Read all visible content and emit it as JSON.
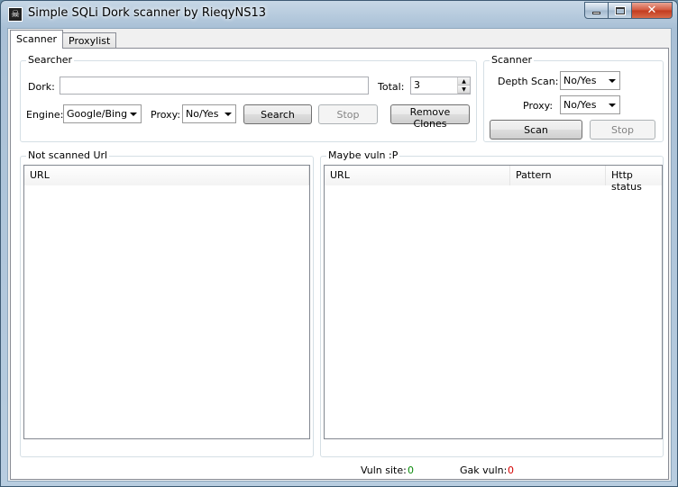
{
  "window": {
    "title": "Simple SQLi Dork scanner by RieqyNS13",
    "icon": "skull-icon"
  },
  "tabs": [
    {
      "label": "Scanner",
      "active": true
    },
    {
      "label": "Proxylist",
      "active": false
    }
  ],
  "searcher": {
    "legend": "Searcher",
    "dork_label": "Dork:",
    "dork_value": "",
    "total_label": "Total:",
    "total_value": "3",
    "engine_label": "Engine:",
    "engine_value": "Google/Bing",
    "proxy_label": "Proxy:",
    "proxy_value": "No/Yes",
    "search_button": "Search",
    "stop_button": "Stop",
    "remove_clones_button": "Remove Clones"
  },
  "scanner": {
    "legend": "Scanner",
    "depth_label": "Depth Scan:",
    "depth_value": "No/Yes",
    "proxy_label": "Proxy:",
    "proxy_value": "No/Yes",
    "scan_button": "Scan",
    "stop_button": "Stop"
  },
  "not_scanned": {
    "legend": "Not scanned Url",
    "columns": [
      "URL"
    ]
  },
  "maybe_vuln": {
    "legend": "Maybe vuln :P",
    "columns": [
      "URL",
      "Pattern",
      "Http status"
    ]
  },
  "status": {
    "vuln_label": "Vuln site:",
    "vuln_count": "0",
    "gak_label": "Gak vuln:",
    "gak_count": "0"
  },
  "colors": {
    "vuln_count": "#0a8a0a",
    "gak_count": "#d40000"
  }
}
